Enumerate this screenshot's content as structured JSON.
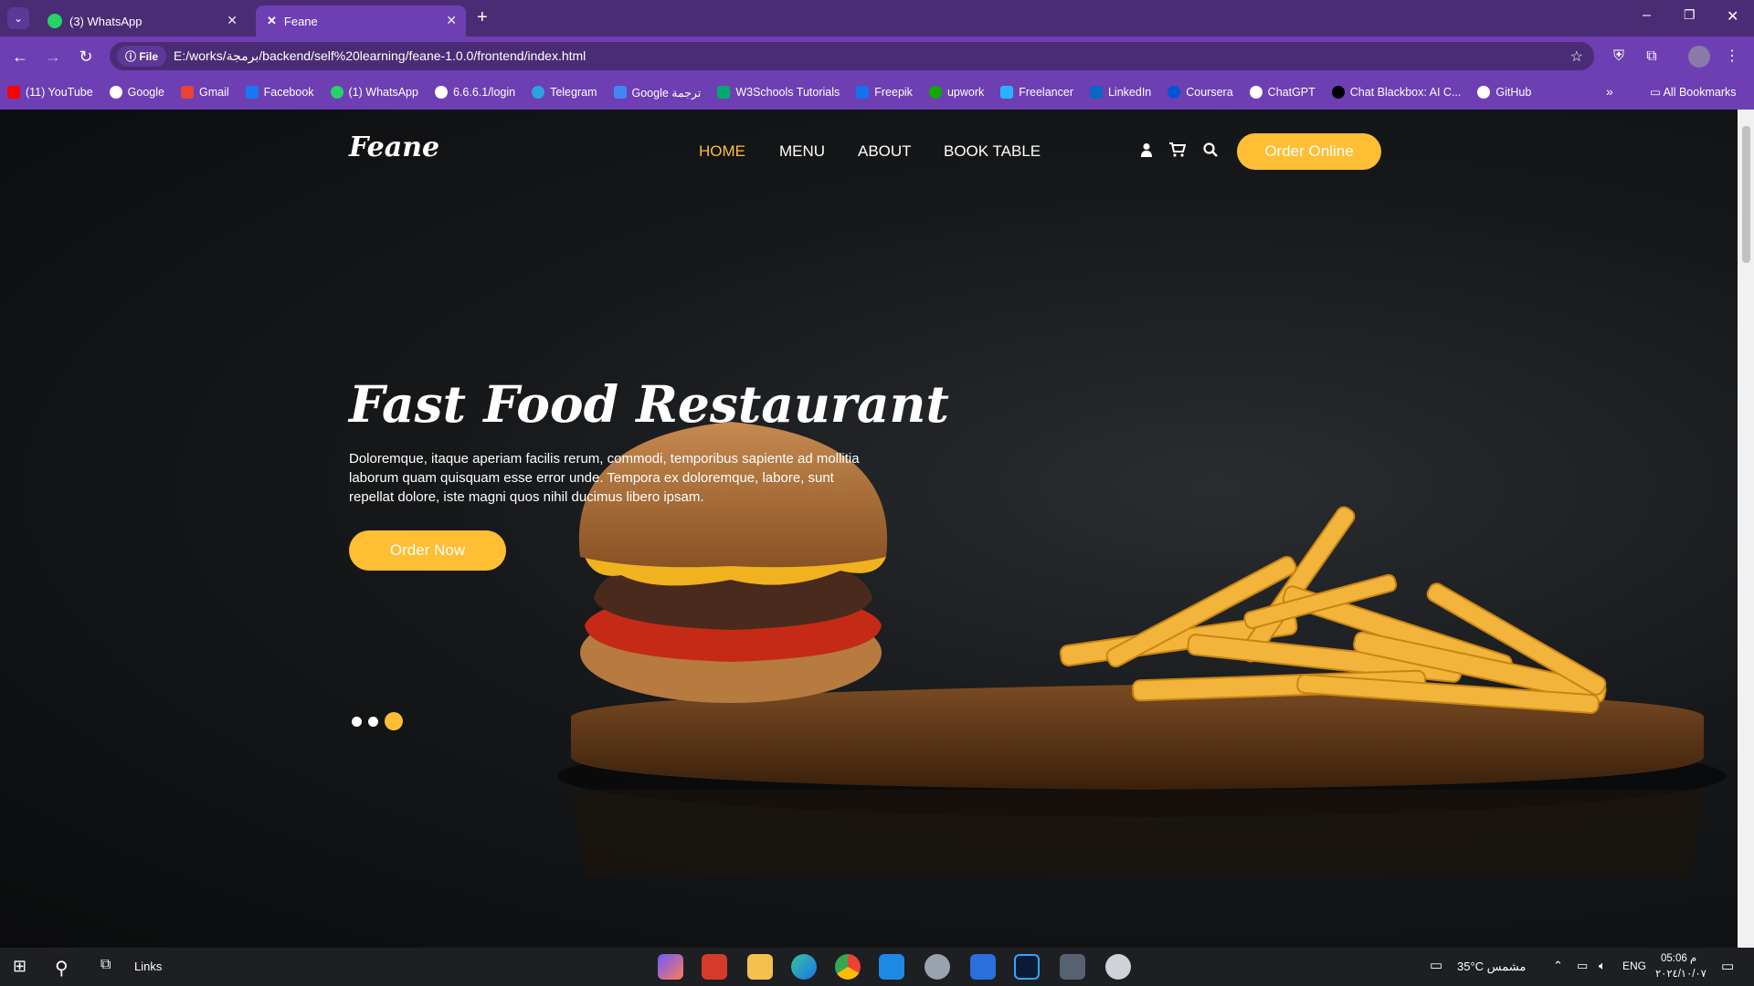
{
  "browser": {
    "tabs": [
      {
        "label": "(3) WhatsApp",
        "color": "#25d366"
      },
      {
        "label": "Feane",
        "color": "#ffffff"
      }
    ],
    "address": {
      "chip": "File",
      "url": "E:/works/برمجة/backend/self%20learning/feane-1.0.0/frontend/index.html"
    },
    "bookmarks": [
      {
        "label": "(11) YouTube",
        "color": "#ff0000"
      },
      {
        "label": "Google",
        "color": "#ffffff"
      },
      {
        "label": "Gmail",
        "color": "#ea4335"
      },
      {
        "label": "Facebook",
        "color": "#1877f2"
      },
      {
        "label": "(1) WhatsApp",
        "color": "#25d366"
      },
      {
        "label": "6.6.6.1/login",
        "color": "#ffffff"
      },
      {
        "label": "Telegram",
        "color": "#2aa3e0"
      },
      {
        "label": "Google ترجمة",
        "color": "#4285f4"
      },
      {
        "label": "W3Schools Tutorials",
        "color": "#04aa6d"
      },
      {
        "label": "Freepik",
        "color": "#1273eb"
      },
      {
        "label": "upwork",
        "color": "#14a800"
      },
      {
        "label": "Freelancer",
        "color": "#29b2fe"
      },
      {
        "label": "LinkedIn",
        "color": "#0a66c2"
      },
      {
        "label": "Coursera",
        "color": "#0056d2"
      },
      {
        "label": "ChatGPT",
        "color": "#ffffff"
      },
      {
        "label": "Chat Blackbox: AI C...",
        "color": "#000000"
      },
      {
        "label": "GitHub",
        "color": "#ffffff"
      }
    ],
    "overflow": "»",
    "all_bookmarks": "All Bookmarks"
  },
  "site": {
    "brand": "Feane",
    "nav": [
      "HOME",
      "MENU",
      "ABOUT",
      "BOOK TABLE"
    ],
    "order_online": "Order Online",
    "hero_title": "Fast Food Restaurant",
    "hero_text": "Doloremque, itaque aperiam facilis rerum, commodi, temporibus sapiente ad mollitia laborum quam quisquam esse error unde. Tempora ex doloremque, labore, sunt repellat dolore, iste magni quos nihil ducimus libero ipsam.",
    "order_now": "Order Now",
    "accent": "#ffbe33"
  },
  "taskbar": {
    "links": "Links",
    "weather": "35°C  مشمس",
    "lang": "ENG",
    "time": "05:06 م",
    "date": "٢٠٢٤/١٠/٠٧"
  }
}
